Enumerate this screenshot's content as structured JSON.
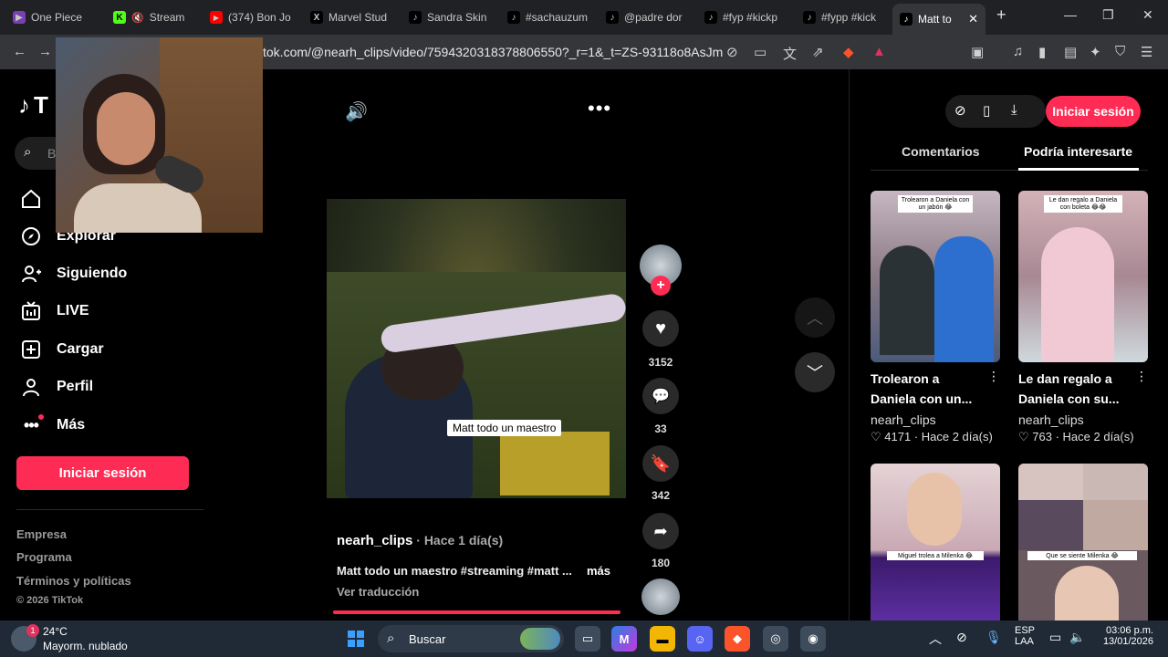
{
  "browser": {
    "tabs": [
      {
        "label": "One Piece",
        "favicon": "play-icon"
      },
      {
        "label": "Stream",
        "favicon": "kick-icon"
      },
      {
        "label": "(374) Bon Jo",
        "favicon": "youtube-icon"
      },
      {
        "label": "Marvel Stud",
        "favicon": "x-icon"
      },
      {
        "label": "Sandra Skin",
        "favicon": "tiktok-icon"
      },
      {
        "label": "#sachauzum",
        "favicon": "tiktok-icon"
      },
      {
        "label": "@padre dor",
        "favicon": "tiktok-icon"
      },
      {
        "label": "#fyp #kickp",
        "favicon": "tiktok-icon"
      },
      {
        "label": "#fypp #kick",
        "favicon": "tiktok-icon"
      },
      {
        "label": "Matt to",
        "favicon": "tiktok-icon",
        "active": true
      }
    ],
    "url": "tok.com/@nearh_clips/video/7594320318378806550?_r=1&_t=ZS-93118o8AsJm"
  },
  "sidebar": {
    "logo": "T",
    "search_placeholder": "B",
    "items": [
      {
        "label": "Explorar",
        "icon": "compass-icon"
      },
      {
        "label": "Siguiendo",
        "icon": "following-icon"
      },
      {
        "label": "LIVE",
        "icon": "live-icon"
      },
      {
        "label": "Cargar",
        "icon": "upload-icon"
      },
      {
        "label": "Perfil",
        "icon": "profile-icon"
      },
      {
        "label": "Más",
        "icon": "more-icon"
      }
    ],
    "login_button": "Iniciar sesión",
    "footer": [
      "Empresa",
      "Programa",
      "Términos y políticas",
      "© 2026 TikTok"
    ]
  },
  "video": {
    "caption_overlay": "Matt todo un maestro",
    "author": "nearh_clips",
    "time_ago": " · Hace 1 día(s)",
    "description": "Matt todo un maestro #streaming #matt ...",
    "more": "más",
    "translate": "Ver traducción"
  },
  "actions": {
    "likes": "3152",
    "comments": "33",
    "saves": "342",
    "shares": "180"
  },
  "right_panel": {
    "login_button": "Iniciar sesión",
    "tabs": [
      "Comentarios",
      "Podría interesarte"
    ],
    "active_tab": "Podría interesarte",
    "cards": [
      {
        "title_line1": "Trolearon a",
        "title_line2": "Daniela con un...",
        "user": "nearh_clips",
        "likes": "4171",
        "time": " · Hace 2 día(s)",
        "thumb_text": "Trolearon a Daniela con un jabón 😂"
      },
      {
        "title_line1": "Le dan regalo a",
        "title_line2": "Daniela con su...",
        "user": "nearh_clips",
        "likes": "763",
        "time": " · Hace 2 día(s)",
        "thumb_text": "Le dan regalo a Daniela con boleta 😂😂"
      },
      {
        "thumb_text": "Miguel trolea a Milenka 😂"
      },
      {
        "thumb_text": "Que se siente Milenka 😂"
      }
    ]
  },
  "taskbar": {
    "weather_temp": "24°C",
    "weather_desc": "Mayorm. nublado",
    "search_label": "Buscar",
    "lang_line1": "ESP",
    "lang_line2": "LAA",
    "time": "03:06 p.m.",
    "date": "13/01/2026"
  },
  "colors": {
    "accent": "#fe2c55",
    "background": "#000000",
    "panel_text": "#ffffff"
  }
}
